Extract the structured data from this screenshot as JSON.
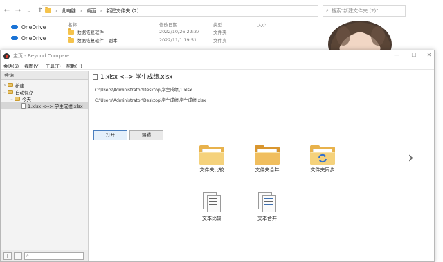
{
  "explorer": {
    "breadcrumbs": [
      "此电脑",
      "桌面",
      "新建文件夹 (2)"
    ],
    "search_placeholder": "搜索\"新建文件夹 (2)\"",
    "sidebar": [
      "OneDrive",
      "OneDrive"
    ],
    "columns": {
      "name": "名称",
      "date": "修改日期",
      "type": "类型",
      "size": "大小"
    },
    "rows": [
      {
        "name": "数据恢复软件",
        "date": "2022/10/26 22:37",
        "type": "文件夹",
        "size": ""
      },
      {
        "name": "数据恢复软件 - 副本",
        "date": "2022/11/1 19:51",
        "type": "文件夹",
        "size": ""
      }
    ]
  },
  "bc": {
    "title": "主页 - Beyond Compare",
    "menu": [
      "会话(S)",
      "视图(V)",
      "工具(T)",
      "帮助(H)"
    ],
    "sessions_header": "会话",
    "tree": {
      "new": "新建",
      "autosave": "自动保存",
      "today": "今天",
      "session": "1.xlsx <--> 学生成绩.xlsx"
    },
    "session_title": "1.xlsx <--> 学生成绩.xlsx",
    "paths": [
      "C:\\Users\\Administrator\\Desktop\\学生成绩\\1.xlsx",
      "C:\\Users\\Administrator\\Desktop\\学生成绩\\学生成绩.xlsx"
    ],
    "buttons": {
      "open": "打开",
      "edit": "编辑"
    },
    "launchers": [
      "文件夹比较",
      "文件夹合并",
      "文件夹同步",
      "文本比较",
      "文本合并"
    ],
    "left_toolbar": {
      "add": "+",
      "remove": "−",
      "search": "⌕"
    }
  }
}
